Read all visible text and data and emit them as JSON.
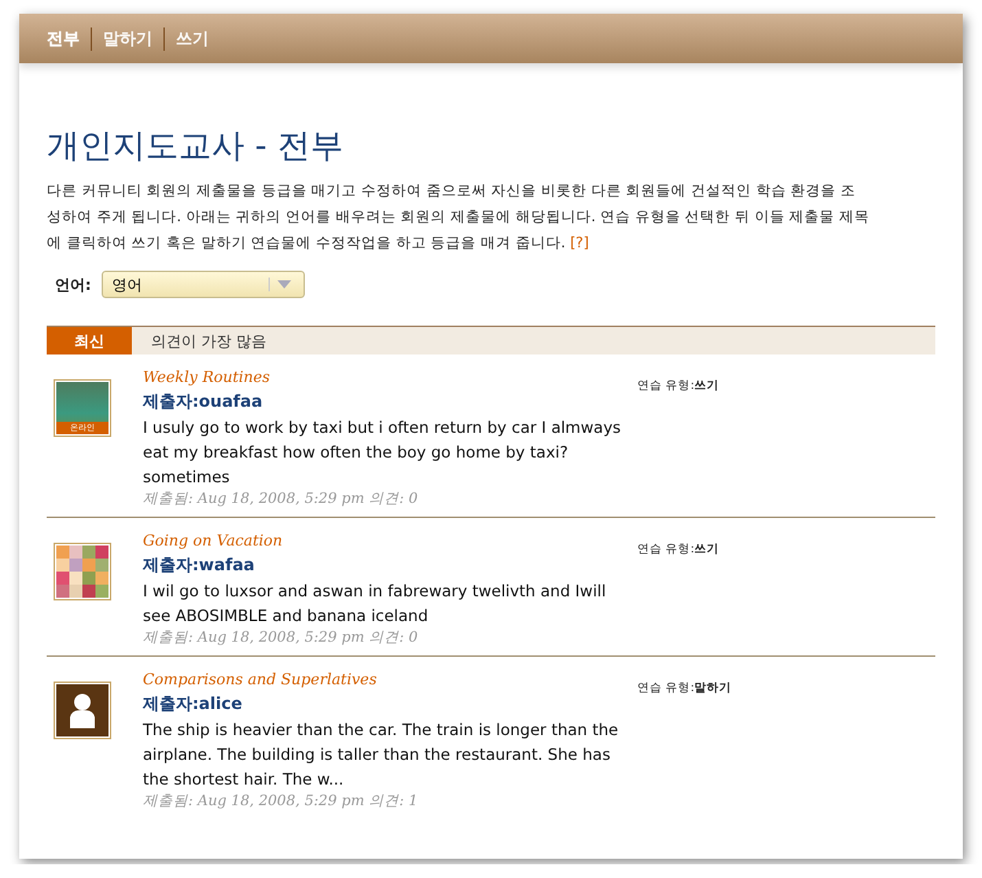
{
  "nav": [
    {
      "label": "전부",
      "selected": true
    },
    {
      "label": "말하기",
      "selected": false
    },
    {
      "label": "쓰기",
      "selected": false
    }
  ],
  "title": "개인지도교사 - 전부",
  "description": "다른 커뮤니티 회원의 제출물을 등급을 매기고 수정하여 줌으로써 자신을 비롯한 다른 회원들에 건설적인 학습 환경을 조성하여 주게 됩니다. 아래는 귀하의 언어를 배우려는 회원의 제출물에 해당됩니다. 연습 유형을 선택한 뒤 이들 제출물 제목에 클릭하여 쓰기 혹은 말하기 연습물에 수정작업을 하고 등급을 매겨 줍니다.",
  "help_link": "[?]",
  "language": {
    "label": "언어:",
    "value": "영어"
  },
  "tabs": [
    {
      "label": "최신",
      "selected": true
    },
    {
      "label": "의견이 가장 많음",
      "selected": false
    }
  ],
  "entries": [
    {
      "kind": "photo",
      "badge": "온라인",
      "title": "Weekly Routines",
      "submitter": "제출자:ouafaa",
      "text": "I usuly go to work by taxi but i often return by car I almways eat my breakfast how often the boy go home by taxi?sometimes",
      "meta": "제출됨: Aug 18, 2008, 5:29 pm 의견: 0",
      "type": "연습 유형:**쓰기**"
    },
    {
      "kind": "pattern",
      "title": "Going on Vacation",
      "submitter": "제출자:wafaa",
      "text": "I wil go to luxsor and aswan in fabrewary twelivth and Iwill see ABOSIMBLE and banana iceland",
      "meta": "제출됨: Aug 18, 2008, 5:29 pm 의견: 0",
      "type": "연습 유형:**쓰기**"
    },
    {
      "kind": "silhouette",
      "title": "Comparisons and Superlatives",
      "submitter": "제출자:alice",
      "text": "The ship is heavier than the car. The train is longer than the airplane. The building is taller than the restaurant. She has the shortest hair. The w...",
      "meta": "제출됨: Aug 18, 2008, 5:29 pm 의견: 1",
      "type": "연습 유형:**말하기**"
    }
  ]
}
